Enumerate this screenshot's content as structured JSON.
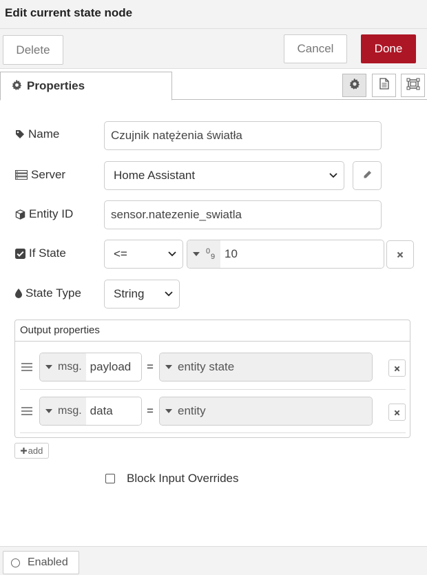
{
  "dialog": {
    "title": "Edit current state node"
  },
  "toolbar": {
    "delete_label": "Delete",
    "cancel_label": "Cancel",
    "done_label": "Done"
  },
  "tabs": {
    "properties_label": "Properties"
  },
  "fields": {
    "name": {
      "label": "Name",
      "value": "Czujnik natężenia światła"
    },
    "server": {
      "label": "Server",
      "selected": "Home Assistant"
    },
    "entity_id": {
      "label": "Entity ID",
      "value": "sensor.natezenie_swiatla"
    },
    "if_state": {
      "label": "If State",
      "operator": "<=",
      "type_glyph_top": "0",
      "type_glyph_bottom": "9",
      "value": "10"
    },
    "state_type": {
      "label": "State Type",
      "selected": "String"
    }
  },
  "output": {
    "header": "Output properties",
    "rows": [
      {
        "prefix": "msg.",
        "property": "payload",
        "equals": "=",
        "value": "entity state"
      },
      {
        "prefix": "msg.",
        "property": "data",
        "equals": "=",
        "value": "entity"
      }
    ],
    "add_label": "add"
  },
  "block_input": {
    "label": "Block Input Overrides"
  },
  "footer": {
    "enabled_label": "Enabled"
  },
  "colors": {
    "done_button": "#ad1625",
    "panel_bg": "#f3f3f3"
  },
  "icons": {
    "tab": "gear-icon",
    "name": "tag-icon",
    "server": "server-icon",
    "entity": "cube-icon",
    "if_state": "checked-box-icon",
    "state_type": "drop-icon"
  }
}
